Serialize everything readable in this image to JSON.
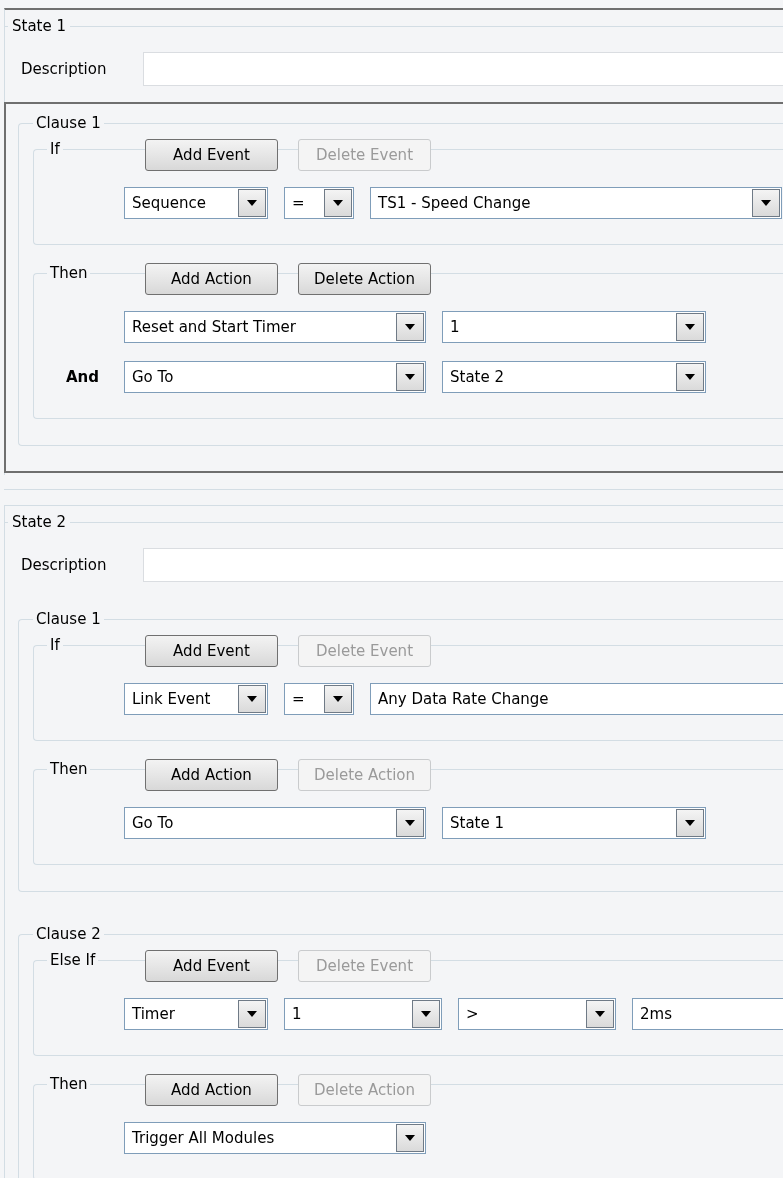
{
  "states": [
    {
      "title": "State 1",
      "selected": true,
      "description_label": "Description",
      "clauses": [
        {
          "title": "Clause 1",
          "sections": [
            {
              "label": "If",
              "buttons": [
                {
                  "label": "Add Event",
                  "disabled": false
                },
                {
                  "label": "Delete Event",
                  "disabled": true
                }
              ],
              "rows": [
                {
                  "fields": [
                    {
                      "kind": "dropdown",
                      "value": "Sequence"
                    },
                    {
                      "kind": "dropdown",
                      "value": "="
                    },
                    {
                      "kind": "dropdown",
                      "value": "TS1 - Speed Change"
                    }
                  ]
                }
              ]
            },
            {
              "label": "Then",
              "buttons": [
                {
                  "label": "Add Action",
                  "disabled": false
                },
                {
                  "label": "Delete Action",
                  "disabled": false
                }
              ],
              "rows": [
                {
                  "fields": [
                    {
                      "kind": "dropdown",
                      "value": "Reset and Start Timer"
                    },
                    {
                      "kind": "dropdown",
                      "value": "1"
                    }
                  ]
                },
                {
                  "label": "And",
                  "fields": [
                    {
                      "kind": "dropdown",
                      "value": "Go To"
                    },
                    {
                      "kind": "dropdown",
                      "value": "State 2"
                    }
                  ]
                }
              ]
            }
          ]
        }
      ]
    },
    {
      "title": "State 2",
      "selected": false,
      "description_label": "Description",
      "clauses": [
        {
          "title": "Clause 1",
          "sections": [
            {
              "label": "If",
              "buttons": [
                {
                  "label": "Add Event",
                  "disabled": false
                },
                {
                  "label": "Delete Event",
                  "disabled": true
                }
              ],
              "rows": [
                {
                  "fields": [
                    {
                      "kind": "dropdown",
                      "value": "Link Event"
                    },
                    {
                      "kind": "dropdown",
                      "value": "="
                    },
                    {
                      "kind": "text",
                      "value": "Any Data Rate Change"
                    }
                  ]
                }
              ]
            },
            {
              "label": "Then",
              "buttons": [
                {
                  "label": "Add Action",
                  "disabled": false
                },
                {
                  "label": "Delete Action",
                  "disabled": true
                }
              ],
              "rows": [
                {
                  "fields": [
                    {
                      "kind": "dropdown",
                      "value": "Go To"
                    },
                    {
                      "kind": "dropdown",
                      "value": "State 1"
                    }
                  ]
                }
              ]
            }
          ]
        },
        {
          "title": "Clause 2",
          "sections": [
            {
              "label": "Else If",
              "buttons": [
                {
                  "label": "Add Event",
                  "disabled": false
                },
                {
                  "label": "Delete Event",
                  "disabled": true
                }
              ],
              "rows": [
                {
                  "fields": [
                    {
                      "kind": "dropdown",
                      "value": "Timer"
                    },
                    {
                      "kind": "dropdown",
                      "value": "1"
                    },
                    {
                      "kind": "dropdown",
                      "value": ">"
                    },
                    {
                      "kind": "text",
                      "value": "2ms"
                    }
                  ]
                }
              ]
            },
            {
              "label": "Then",
              "buttons": [
                {
                  "label": "Add Action",
                  "disabled": false
                },
                {
                  "label": "Delete Action",
                  "disabled": true
                }
              ],
              "rows": [
                {
                  "fields": [
                    {
                      "kind": "dropdown",
                      "value": "Trigger All Modules"
                    }
                  ]
                }
              ]
            }
          ]
        }
      ]
    }
  ]
}
